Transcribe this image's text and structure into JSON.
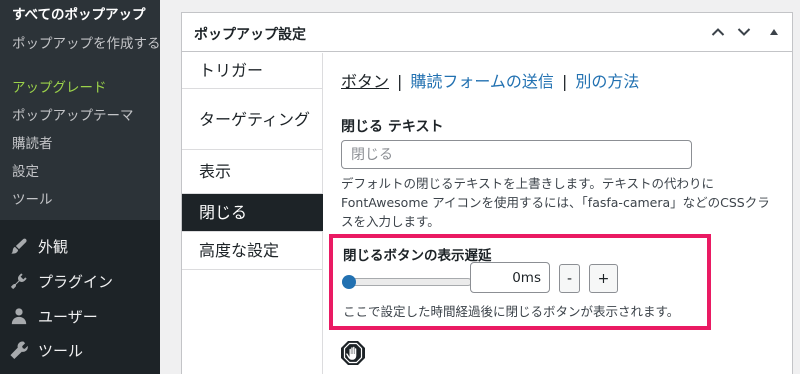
{
  "sidebar": {
    "submenu": [
      {
        "label": "すべてのポップアップ",
        "current": true
      },
      {
        "label": "ポップアップを作成する"
      },
      {
        "label": "アップグレード",
        "upgrade": true
      },
      {
        "label": "ポップアップテーマ"
      },
      {
        "label": "購読者"
      },
      {
        "label": "設定"
      },
      {
        "label": "ツール"
      }
    ],
    "menu": [
      {
        "label": "外観",
        "icon": "paintbrush-icon"
      },
      {
        "label": "プラグイン",
        "icon": "plugin-icon"
      },
      {
        "label": "ユーザー",
        "icon": "user-icon"
      },
      {
        "label": "ツール",
        "icon": "wrench-icon"
      }
    ]
  },
  "postbox": {
    "title": "ポップアップ設定",
    "controls": [
      "chevron-up-icon",
      "chevron-down-icon",
      "triangle-up-icon"
    ]
  },
  "tabs": [
    {
      "label": "トリガー"
    },
    {
      "label": "ターゲティング"
    },
    {
      "label": "表示"
    },
    {
      "label": "閉じる",
      "active": true
    },
    {
      "label": "高度な設定"
    }
  ],
  "subtabs": [
    {
      "label": "ボタン",
      "active": true
    },
    {
      "label": "購読フォームの送信"
    },
    {
      "label": "別の方法"
    }
  ],
  "subtab_separator": "|",
  "close_text": {
    "label": "閉じる テキスト",
    "placeholder": "閉じる",
    "description": "デフォルトの閉じるテキストを上書きします。テキストの代わりに FontAwesome アイコンを使用するには、「fasfa-camera」などのCSSクラスを入力します。"
  },
  "close_delay": {
    "label": "閉じるボタンの表示遅延",
    "value": "0ms",
    "slider_fraction": 0,
    "minus_label": "-",
    "plus_label": "+",
    "description": "ここで設定した時間経過後に閉じるボタンが表示されます。",
    "highlight_color": "#ea1a63"
  },
  "colors": {
    "sidebar_bg": "#1d2327",
    "accent": "#2271b1",
    "upgrade": "#9bd24a"
  },
  "footer_icon": "stop-hand-icon"
}
